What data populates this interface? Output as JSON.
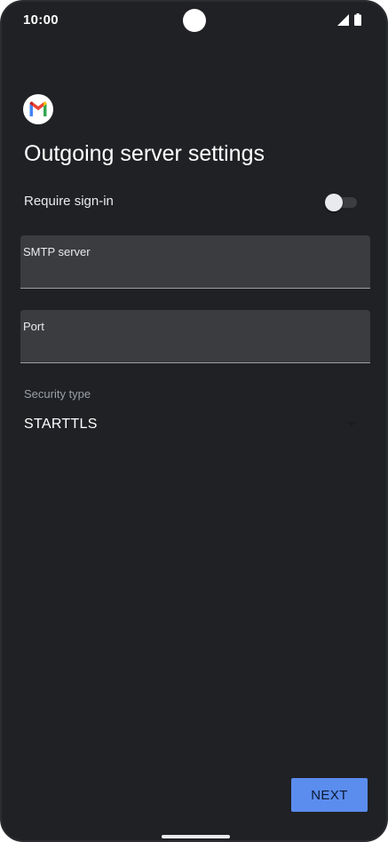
{
  "status_bar": {
    "time": "10:00",
    "icons": [
      "signal-icon",
      "battery-icon"
    ]
  },
  "app": {
    "logo": "gmail-logo",
    "colors": {
      "background": "#202124",
      "field_background": "#3b3c3f",
      "accent": "#5b8def"
    }
  },
  "page": {
    "title": "Outgoing server settings"
  },
  "require_signin": {
    "label": "Require sign-in",
    "enabled": false
  },
  "smtp_server": {
    "label": "SMTP server",
    "value": ""
  },
  "port": {
    "label": "Port",
    "value": ""
  },
  "security": {
    "label": "Security type",
    "value": "STARTTLS"
  },
  "actions": {
    "next_label": "NEXT"
  }
}
